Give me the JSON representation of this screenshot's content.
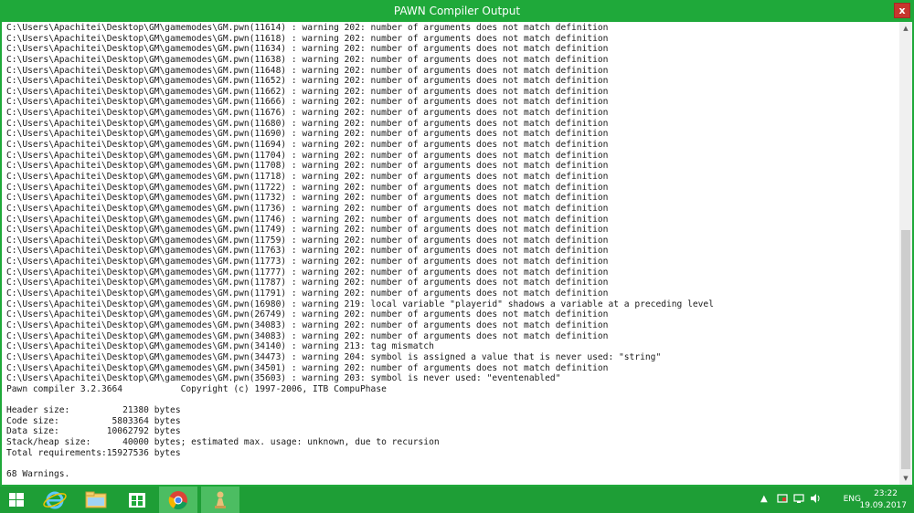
{
  "window": {
    "title": "PAWN Compiler Output",
    "close_label": "x"
  },
  "output_lines": [
    "C:\\Users\\Apachitei\\Desktop\\GM\\gamemodes\\GM.pwn(11614) : warning 202: number of arguments does not match definition",
    "C:\\Users\\Apachitei\\Desktop\\GM\\gamemodes\\GM.pwn(11618) : warning 202: number of arguments does not match definition",
    "C:\\Users\\Apachitei\\Desktop\\GM\\gamemodes\\GM.pwn(11634) : warning 202: number of arguments does not match definition",
    "C:\\Users\\Apachitei\\Desktop\\GM\\gamemodes\\GM.pwn(11638) : warning 202: number of arguments does not match definition",
    "C:\\Users\\Apachitei\\Desktop\\GM\\gamemodes\\GM.pwn(11648) : warning 202: number of arguments does not match definition",
    "C:\\Users\\Apachitei\\Desktop\\GM\\gamemodes\\GM.pwn(11652) : warning 202: number of arguments does not match definition",
    "C:\\Users\\Apachitei\\Desktop\\GM\\gamemodes\\GM.pwn(11662) : warning 202: number of arguments does not match definition",
    "C:\\Users\\Apachitei\\Desktop\\GM\\gamemodes\\GM.pwn(11666) : warning 202: number of arguments does not match definition",
    "C:\\Users\\Apachitei\\Desktop\\GM\\gamemodes\\GM.pwn(11676) : warning 202: number of arguments does not match definition",
    "C:\\Users\\Apachitei\\Desktop\\GM\\gamemodes\\GM.pwn(11680) : warning 202: number of arguments does not match definition",
    "C:\\Users\\Apachitei\\Desktop\\GM\\gamemodes\\GM.pwn(11690) : warning 202: number of arguments does not match definition",
    "C:\\Users\\Apachitei\\Desktop\\GM\\gamemodes\\GM.pwn(11694) : warning 202: number of arguments does not match definition",
    "C:\\Users\\Apachitei\\Desktop\\GM\\gamemodes\\GM.pwn(11704) : warning 202: number of arguments does not match definition",
    "C:\\Users\\Apachitei\\Desktop\\GM\\gamemodes\\GM.pwn(11708) : warning 202: number of arguments does not match definition",
    "C:\\Users\\Apachitei\\Desktop\\GM\\gamemodes\\GM.pwn(11718) : warning 202: number of arguments does not match definition",
    "C:\\Users\\Apachitei\\Desktop\\GM\\gamemodes\\GM.pwn(11722) : warning 202: number of arguments does not match definition",
    "C:\\Users\\Apachitei\\Desktop\\GM\\gamemodes\\GM.pwn(11732) : warning 202: number of arguments does not match definition",
    "C:\\Users\\Apachitei\\Desktop\\GM\\gamemodes\\GM.pwn(11736) : warning 202: number of arguments does not match definition",
    "C:\\Users\\Apachitei\\Desktop\\GM\\gamemodes\\GM.pwn(11746) : warning 202: number of arguments does not match definition",
    "C:\\Users\\Apachitei\\Desktop\\GM\\gamemodes\\GM.pwn(11749) : warning 202: number of arguments does not match definition",
    "C:\\Users\\Apachitei\\Desktop\\GM\\gamemodes\\GM.pwn(11759) : warning 202: number of arguments does not match definition",
    "C:\\Users\\Apachitei\\Desktop\\GM\\gamemodes\\GM.pwn(11763) : warning 202: number of arguments does not match definition",
    "C:\\Users\\Apachitei\\Desktop\\GM\\gamemodes\\GM.pwn(11773) : warning 202: number of arguments does not match definition",
    "C:\\Users\\Apachitei\\Desktop\\GM\\gamemodes\\GM.pwn(11777) : warning 202: number of arguments does not match definition",
    "C:\\Users\\Apachitei\\Desktop\\GM\\gamemodes\\GM.pwn(11787) : warning 202: number of arguments does not match definition",
    "C:\\Users\\Apachitei\\Desktop\\GM\\gamemodes\\GM.pwn(11791) : warning 202: number of arguments does not match definition",
    "C:\\Users\\Apachitei\\Desktop\\GM\\gamemodes\\GM.pwn(16980) : warning 219: local variable \"playerid\" shadows a variable at a preceding level",
    "C:\\Users\\Apachitei\\Desktop\\GM\\gamemodes\\GM.pwn(26749) : warning 202: number of arguments does not match definition",
    "C:\\Users\\Apachitei\\Desktop\\GM\\gamemodes\\GM.pwn(34083) : warning 202: number of arguments does not match definition",
    "C:\\Users\\Apachitei\\Desktop\\GM\\gamemodes\\GM.pwn(34083) : warning 202: number of arguments does not match definition",
    "C:\\Users\\Apachitei\\Desktop\\GM\\gamemodes\\GM.pwn(34140) : warning 213: tag mismatch",
    "C:\\Users\\Apachitei\\Desktop\\GM\\gamemodes\\GM.pwn(34473) : warning 204: symbol is assigned a value that is never used: \"string\"",
    "C:\\Users\\Apachitei\\Desktop\\GM\\gamemodes\\GM.pwn(34501) : warning 202: number of arguments does not match definition",
    "C:\\Users\\Apachitei\\Desktop\\GM\\gamemodes\\GM.pwn(35603) : warning 203: symbol is never used: \"eventenabled\"",
    "Pawn compiler 3.2.3664           Copyright (c) 1997-2006, ITB CompuPhase",
    "",
    "Header size:          21380 bytes",
    "Code size:          5803364 bytes",
    "Data size:         10062792 bytes",
    "Stack/heap size:      40000 bytes; estimated max. usage: unknown, due to recursion",
    "Total requirements:15927536 bytes",
    "",
    "68 Warnings."
  ],
  "taskbar": {
    "apps": [
      {
        "name": "start-button",
        "icon": "windows-logo-icon"
      },
      {
        "name": "internet-explorer",
        "icon": "internet-explorer-icon"
      },
      {
        "name": "file-explorer",
        "icon": "folder-icon"
      },
      {
        "name": "store",
        "icon": "store-icon"
      },
      {
        "name": "chrome",
        "icon": "chrome-icon"
      },
      {
        "name": "pawno",
        "icon": "pawno-icon"
      }
    ],
    "tray": {
      "lang": "ENG",
      "time": "23:22",
      "date": "19.09.2017"
    }
  },
  "colors": {
    "frame": "#1fa93a",
    "taskbar": "#1e9e36",
    "close": "#c7362e",
    "text": "#1a1a1a"
  }
}
